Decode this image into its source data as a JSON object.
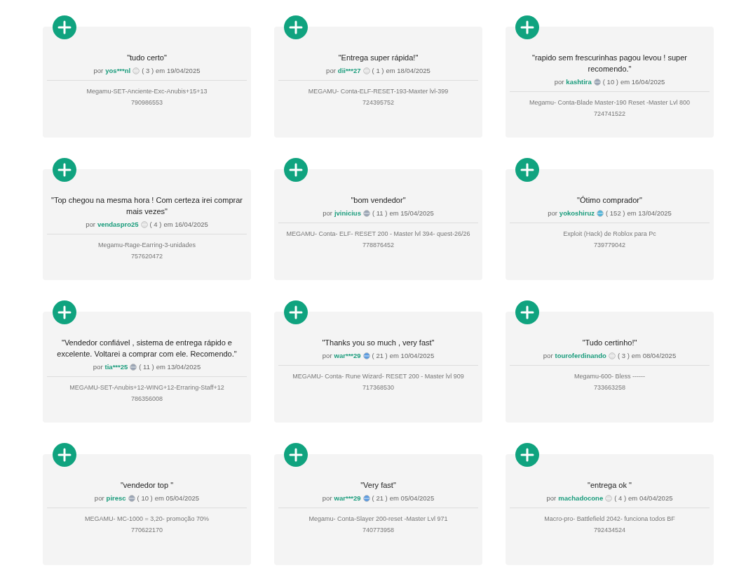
{
  "reviews": [
    {
      "quote": "\"tudo certo\"",
      "by": "por",
      "user": "yos***nl",
      "color": "#e2e2e2",
      "score": "( 3 )",
      "date": "em 19/04/2025",
      "product": "Megamu-SET-Anciente-Exc-Anubis+15+13",
      "order": "790986553"
    },
    {
      "quote": "\"Entrega super rápida!\"",
      "by": "por",
      "user": "dii***27",
      "color": "#e2e2e2",
      "score": "( 1 )",
      "date": "em 18/04/2025",
      "product": "MEGAMU- Conta-ELF-RESET-193-Maxter lvl-399",
      "order": "724395752"
    },
    {
      "quote": "\"rapido sem frescurinhas pagou levou ! super recomendo.\"",
      "by": "por",
      "user": "kashtira",
      "color": "#9aa5b5",
      "score": "( 10 )",
      "date": "em 16/04/2025",
      "product": "Megamu- Conta-Blade Master-190 Reset -Master Lvl 800",
      "order": "724741522"
    },
    {
      "quote": "\"Top chegou na mesma hora ! Com certeza irei comprar mais vezes\"",
      "by": "por",
      "user": "vendaspro25",
      "color": "#e2e2e2",
      "score": "( 4 )",
      "date": "em 16/04/2025",
      "product": "Megamu-Rage-Earring-3-unidades",
      "order": "757620472"
    },
    {
      "quote": "\"bom vendedor\"",
      "by": "por",
      "user": "jvinicius",
      "color": "#9aa5b5",
      "score": "( 11 )",
      "date": "em 15/04/2025",
      "product": "MEGAMU- Conta- ELF- RESET 200 - Master lvl 394- quest-26/26",
      "order": "778876452"
    },
    {
      "quote": "\"Ótimo comprador\"",
      "by": "por",
      "user": "yokoshiruz",
      "color": "#4fb3d9",
      "score": "( 152 )",
      "date": "em 13/04/2025",
      "product": "Exploit (Hack) de Roblox para Pc",
      "order": "739779042"
    },
    {
      "quote": "\"Vendedor confiável , sistema de entrega rápido e excelente. Voltarei a comprar com ele. Recomendo.\"",
      "by": "por",
      "user": "tia***25",
      "color": "#9aa5b5",
      "score": "( 11 )",
      "date": "em 13/04/2025",
      "product": "MEGAMU-SET-Anubis+12-WING+12-Erraring-Staff+12",
      "order": "786356008"
    },
    {
      "quote": "\"Thanks you so much , very fast\"",
      "by": "por",
      "user": "war***29",
      "color": "#5b9be0",
      "score": "( 21 )",
      "date": "em 10/04/2025",
      "product": "MEGAMU- Conta- Rune Wizard- RESET 200 - Master lvl 909",
      "order": "717368530"
    },
    {
      "quote": "\"Tudo certinho!\"",
      "by": "por",
      "user": "touroferdinando",
      "color": "#e2e2e2",
      "score": "( 3 )",
      "date": "em 08/04/2025",
      "product": "Megamu-600- Bless ------",
      "order": "733663258"
    },
    {
      "quote": "\"vendedor top \"",
      "by": "por",
      "user": "piresc",
      "color": "#9aa5b5",
      "score": "( 10 )",
      "date": "em 05/04/2025",
      "product": "MEGAMU- MC-1000 = 3,20- promoção 70%",
      "order": "770622170"
    },
    {
      "quote": "\"Very fast\"",
      "by": "por",
      "user": "war***29",
      "color": "#5b9be0",
      "score": "( 21 )",
      "date": "em 05/04/2025",
      "product": "Megamu- Conta-Slayer 200-reset -Master Lvl 971",
      "order": "740773958"
    },
    {
      "quote": "\"entrega ok \"",
      "by": "por",
      "user": "machadocone",
      "color": "#e2e2e2",
      "score": "( 4 )",
      "date": "em 04/04/2025",
      "product": "Macro-pro- Battlefield 2042- funciona todos BF",
      "order": "792434524"
    }
  ]
}
